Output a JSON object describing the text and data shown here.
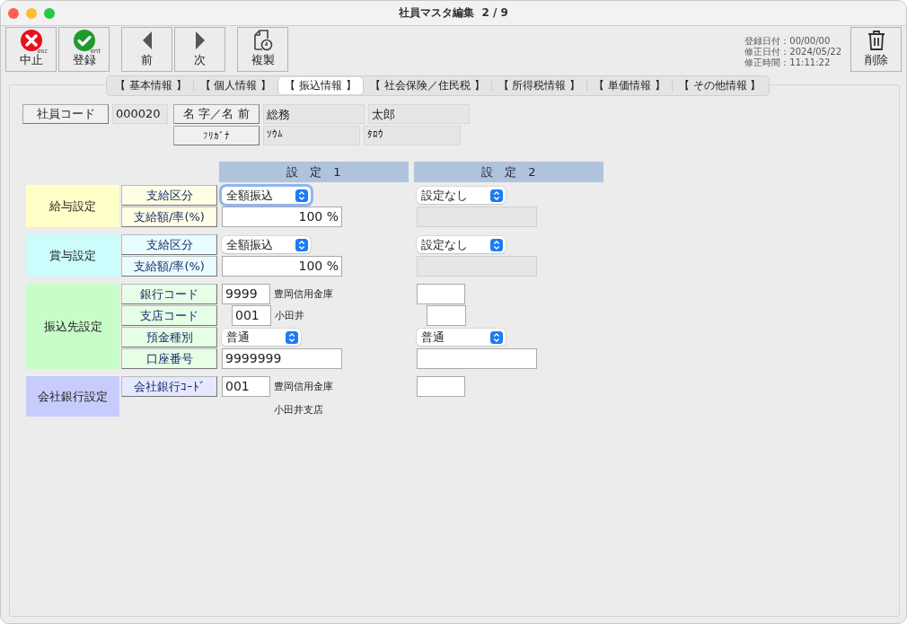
{
  "window": {
    "title": "社員マスタ編集  2 / 9"
  },
  "toolbar": {
    "groups": [
      [
        {
          "kind": "cancel",
          "label": "中止",
          "hint": "esc"
        },
        {
          "kind": "register",
          "label": "登録",
          "hint": "ent"
        }
      ],
      [
        {
          "kind": "prev",
          "label": "前"
        },
        {
          "kind": "next",
          "label": "次"
        }
      ],
      [
        {
          "kind": "copy",
          "label": "複製"
        }
      ]
    ],
    "info": [
      "登録日付：00/00/00",
      "修正日付：2024/05/22",
      "修正時間：11:11:22"
    ],
    "delete": {
      "label": "削除"
    }
  },
  "tabs": [
    {
      "label": "【 基本情報 】",
      "selected": false
    },
    {
      "label": "【 個人情報 】",
      "selected": false
    },
    {
      "label": "【 振込情報 】",
      "selected": true
    },
    {
      "label": "【 社会保険／住民税 】",
      "selected": false
    },
    {
      "label": "【 所得税情報 】",
      "selected": false
    },
    {
      "label": "【 単価情報 】",
      "selected": false
    },
    {
      "label": "【 その他情報 】",
      "selected": false
    }
  ],
  "employee": {
    "code_label": "社員コード",
    "code": "000020",
    "name_label": "名 字／名 前",
    "last_name": "総務",
    "first_name": "太郎",
    "kana_label": "ﾌﾘｶﾞﾅ",
    "last_kana": "ｿｳﾑ",
    "first_kana": "ﾀﾛｳ"
  },
  "settings": {
    "headers": [
      "設　定　1",
      "設　定　2"
    ],
    "groups": [
      {
        "label": "給与設定",
        "color": "#ffffc8",
        "rows": [
          {
            "label": "支給区分",
            "cells": [
              {
                "kind": "select",
                "value": "全額振込",
                "focused": true
              },
              {
                "kind": "select",
                "value": "設定なし",
                "focused": false
              }
            ]
          },
          {
            "label": "支給額/率(%)",
            "cells": [
              {
                "kind": "amount",
                "value": "100",
                "unit": "%"
              },
              {
                "kind": "disabled"
              }
            ]
          }
        ]
      },
      {
        "label": "賞与設定",
        "color": "#ccfcfc",
        "rows": [
          {
            "label": "支給区分",
            "cells": [
              {
                "kind": "select",
                "value": "全額振込",
                "focused": false
              },
              {
                "kind": "select",
                "value": "設定なし",
                "focused": false
              }
            ]
          },
          {
            "label": "支給額/率(%)",
            "cells": [
              {
                "kind": "amount",
                "value": "100",
                "unit": "%"
              },
              {
                "kind": "disabled"
              }
            ]
          }
        ]
      },
      {
        "label": "振込先設定",
        "color": "#c8fcc8",
        "rows": [
          {
            "label": "銀行コード",
            "cells": [
              {
                "kind": "code",
                "value": "9999",
                "name": "豊岡信用金庫",
                "indent": false
              },
              {
                "kind": "code",
                "indent": false
              }
            ]
          },
          {
            "label": "支店コード",
            "cells": [
              {
                "kind": "code",
                "value": "001",
                "name": "小田井",
                "indent": true
              },
              {
                "kind": "code",
                "indent": true
              }
            ]
          },
          {
            "label": "預金種別",
            "cells": [
              {
                "kind": "select",
                "value": "普通",
                "focused": false,
                "short": true
              },
              {
                "kind": "select",
                "value": "普通",
                "focused": false
              }
            ]
          },
          {
            "label": "口座番号",
            "cells": [
              {
                "kind": "field",
                "value": "9999999"
              },
              {
                "kind": "field"
              }
            ]
          }
        ]
      },
      {
        "label": "会社銀行設定",
        "color": "#c8ccfc",
        "rows": [
          {
            "label": "会社銀行ｺｰﾄﾞ",
            "cells": [
              {
                "kind": "code",
                "value": "001",
                "name": "豊岡信用金庫",
                "indent": false,
                "branch": "小田井支店"
              },
              {
                "kind": "code",
                "indent": false
              }
            ]
          }
        ]
      }
    ]
  }
}
